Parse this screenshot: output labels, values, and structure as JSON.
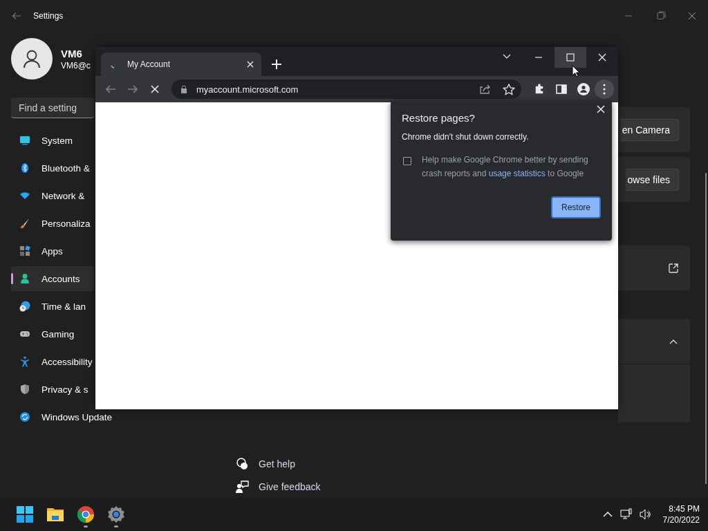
{
  "settings": {
    "title": "Settings",
    "user": {
      "name": "VM6",
      "email": "VM6@c"
    },
    "search": {
      "placeholder": "Find a setting"
    },
    "nav": [
      {
        "label": "System",
        "selected": false
      },
      {
        "label": "Bluetooth &",
        "selected": false
      },
      {
        "label": "Network &",
        "selected": false
      },
      {
        "label": "Personaliza",
        "selected": false
      },
      {
        "label": "Apps",
        "selected": false
      },
      {
        "label": "Accounts",
        "selected": true
      },
      {
        "label": "Time & lan",
        "selected": false
      },
      {
        "label": "Gaming",
        "selected": false
      },
      {
        "label": "Accessibility",
        "selected": false
      },
      {
        "label": "Privacy & s",
        "selected": false
      },
      {
        "label": "Windows Update",
        "selected": false
      }
    ],
    "cards": [
      {
        "kind": "button",
        "label": "en Camera"
      },
      {
        "kind": "button",
        "label": "owse files"
      },
      {
        "kind": "link"
      },
      {
        "kind": "expander",
        "expanded": true
      }
    ],
    "help_links": [
      "Get help",
      "Give feedback"
    ]
  },
  "browser": {
    "tab": {
      "title": "My Account",
      "loading": true
    },
    "url": "myaccount.microsoft.com",
    "dialog": {
      "title": "Restore pages?",
      "message": "Chrome didn't shut down correctly.",
      "consent": {
        "checked": false,
        "text_before": "Help make Google Chrome better by sending crash reports and ",
        "link": "usage statistics",
        "text_after": " to Google"
      },
      "button": "Restore"
    }
  },
  "taskbar": {
    "apps": [
      {
        "kind": "start",
        "running": false
      },
      {
        "kind": "explorer",
        "running": false
      },
      {
        "kind": "chrome",
        "running": true
      },
      {
        "kind": "settings",
        "running": true
      }
    ],
    "time": "8:45 PM",
    "date": "7/20/2022"
  }
}
